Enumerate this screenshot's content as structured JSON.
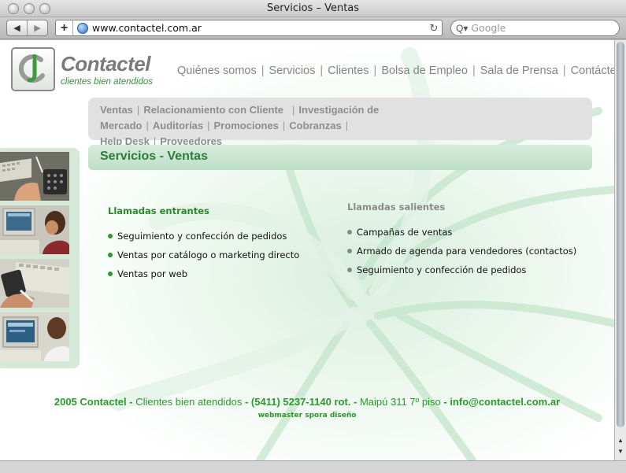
{
  "window": {
    "title": "Servicios – Ventas"
  },
  "toolbar": {
    "back_label": "◀",
    "forward_label": "▶",
    "add_label": "+",
    "url": "www.contactel.com.ar",
    "reload_label": "↻",
    "search_placeholder": "Google",
    "search_glass": "Q▾"
  },
  "brand": {
    "name": "Contactel",
    "tagline": "clientes bien atendidos"
  },
  "main_nav": [
    "Quiénes somos",
    "Servicios",
    "Clientes",
    "Bolsa de Empleo",
    "Sala de Prensa",
    "Contáctenos"
  ],
  "sub_nav": {
    "row1": [
      "Ventas",
      "Relacionamiento con Cliente",
      "Investigación de Mercado",
      "Auditorías",
      "Promociones",
      "Cobranzas"
    ],
    "row2": [
      "Help Desk",
      "Proveedores"
    ]
  },
  "heading": "Servicios - Ventas",
  "inbound": {
    "title": "Llamadas entrantes",
    "items": [
      "Seguimiento y confección de pedidos",
      "Ventas por catálogo o marketing directo",
      "Ventas por web"
    ]
  },
  "outbound": {
    "title": "Llamadas salientes",
    "items": [
      "Campañas de ventas",
      "Armado de agenda para vendedores (contactos)",
      "Seguimiento y confección de pedidos"
    ]
  },
  "footer": {
    "year_brand": "2005 Contactel -",
    "tagline": "Clientes bien atendidos",
    "phone": "- (5411) 5237-1140 rot. -",
    "address": "Maipú 311 7º piso",
    "email": "- info@contactel.com.ar",
    "credit": "webmaster spora diseño"
  },
  "colors": {
    "accent_green": "#2e7d3a",
    "inbound_bullet": "#2a9a2a",
    "outbound_bullet": "#888888"
  }
}
